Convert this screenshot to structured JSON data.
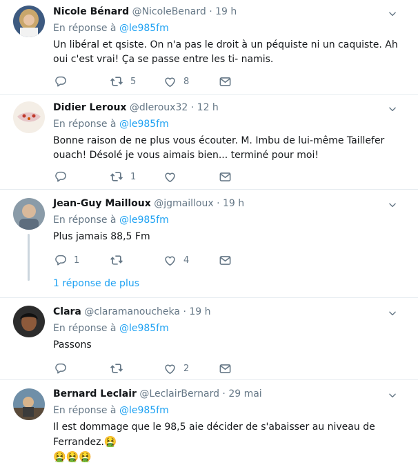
{
  "tweets": [
    {
      "name": "Nicole Bénard",
      "handle": "@NicoleBenard",
      "time": "19 h",
      "reply_prefix": "En réponse à ",
      "reply_to": "@le985fm",
      "text": "Un libéral et qsiste.  On n'a pas le droit à un péquiste ni un caquiste. Ah oui c'est vrai! Ça se passe entre les ti- namis.",
      "counts": {
        "reply": "",
        "retweet": "5",
        "like": "8"
      }
    },
    {
      "name": "Didier Leroux",
      "handle": "@dleroux32",
      "time": "12 h",
      "reply_prefix": "En réponse à ",
      "reply_to": "@le985fm",
      "text": "Bonne raison de ne plus vous écouter. M. Imbu de lui-même Taillefer ouach! Désolé je vous aimais bien... terminé pour moi!",
      "counts": {
        "reply": "",
        "retweet": "1",
        "like": ""
      }
    },
    {
      "name": "Jean-Guy Mailloux",
      "handle": "@jgmailloux",
      "time": "19 h",
      "reply_prefix": "En réponse à ",
      "reply_to": "@le985fm",
      "text": "Plus jamais 88,5 Fm",
      "counts": {
        "reply": "1",
        "retweet": "",
        "like": "4"
      },
      "more_replies": "1 réponse de plus"
    },
    {
      "name": "Clara",
      "handle": "@claramanoucheka",
      "time": "19 h",
      "reply_prefix": "En réponse à ",
      "reply_to": "@le985fm",
      "text": "Passons",
      "counts": {
        "reply": "",
        "retweet": "",
        "like": "2"
      }
    },
    {
      "name": "Bernard Leclair",
      "handle": "@LeclairBernard",
      "time": "29 mai",
      "reply_prefix": "En réponse à ",
      "reply_to": "@le985fm",
      "text": "Il est dommage que le 98,5 aie décider de s'abaisser au niveau de Ferrandez.",
      "emoji_inline": "🤮",
      "emoji_line": "🤮🤮🤮"
    }
  ],
  "separator": "·",
  "colors": {
    "accent": "#1da1f2",
    "muted": "#657786",
    "text": "#14171a",
    "border": "#e6ecf0"
  },
  "icons": [
    "chevron-down-icon",
    "reply-icon",
    "retweet-icon",
    "like-icon",
    "direct-message-icon"
  ]
}
